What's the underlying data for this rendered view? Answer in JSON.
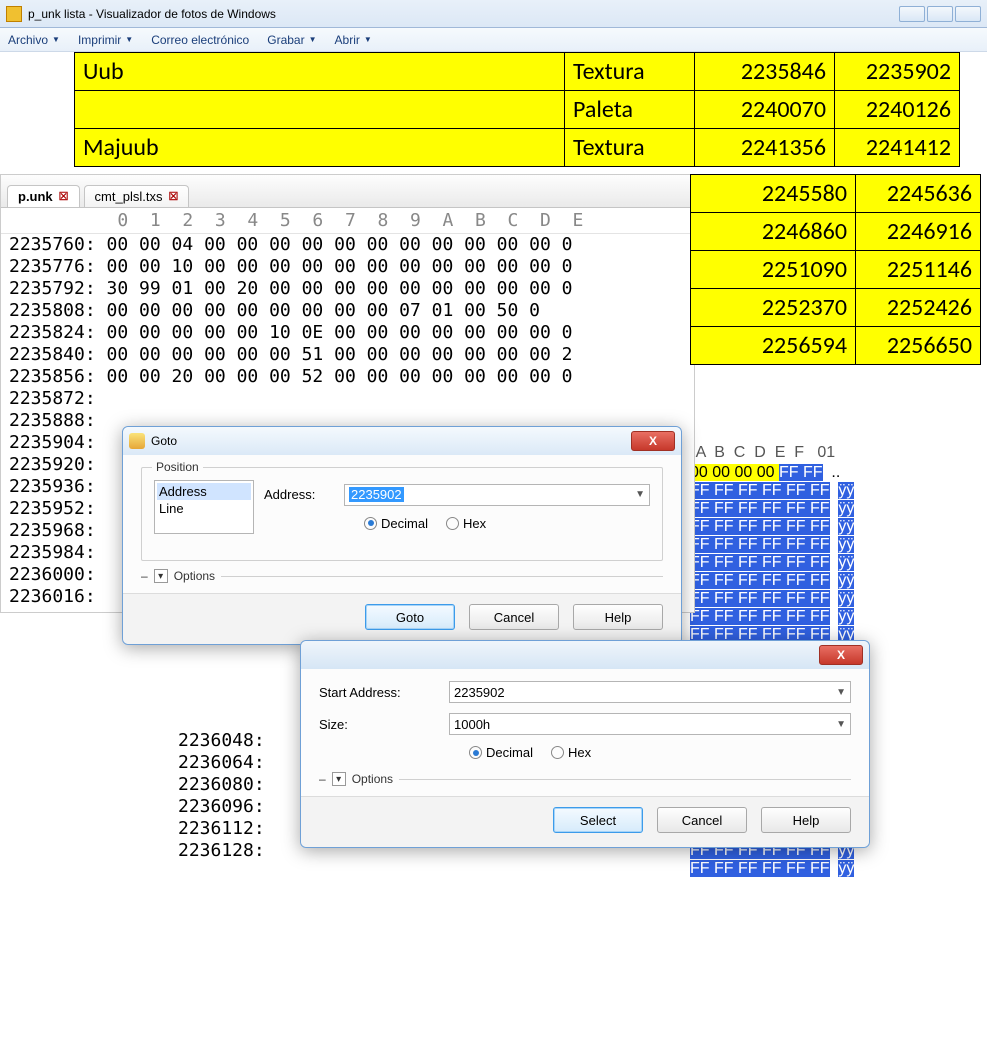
{
  "window": {
    "title": "p_unk lista - Visualizador de fotos de Windows"
  },
  "menubar": {
    "items": [
      "Archivo",
      "Imprimir",
      "Correo electrónico",
      "Grabar",
      "Abrir"
    ]
  },
  "yellow_table": {
    "rows": [
      {
        "name": "Uub",
        "type": "Textura",
        "a": "2235846",
        "b": "2235902"
      },
      {
        "name": "",
        "type": "Paleta",
        "a": "2240070",
        "b": "2240126"
      },
      {
        "name": "Majuub",
        "type": "Textura",
        "a": "2241356",
        "b": "2241412"
      }
    ],
    "tail": [
      {
        "a": "2245580",
        "b": "2245636"
      },
      {
        "a": "2246860",
        "b": "2246916"
      },
      {
        "a": "2251090",
        "b": "2251146"
      },
      {
        "a": "2252370",
        "b": "2252426"
      },
      {
        "a": "2256594",
        "b": "2256650"
      }
    ]
  },
  "hex_tabs": {
    "active": "p.unk",
    "other": "cmt_plsl.txs"
  },
  "hex_header": "          0  1  2  3  4  5  6  7  8  9  A  B  C  D  E",
  "hex_rows": [
    "2235760: 00 00 04 00 00 00 00 00 00 00 00 00 00 00 0",
    "2235776: 00 00 10 00 00 00 00 00 00 00 00 00 00 00 0",
    "2235792: 30 99 01 00 20 00 00 00 00 00 00 00 00 00 0",
    "2235808: 00 00 00 00 00 00 00 00 00 07 01 00 50 0",
    "2235824: 00 00 00 00 00 10 0E 00 00 00 00 00 00 00 0",
    "2235840: 00 00 00 00 00 00 51 00 00 00 00 00 00 00 2",
    "2235856: 00 00 20 00 00 00 52 00 00 00 00 00 00 00 0",
    "2235872:",
    "2235888:",
    "2235904:",
    "2235920:",
    "2235936:",
    "2235952:",
    "2235968:",
    "2235984:",
    "2236000:",
    "2236016:"
  ],
  "hex2_rows": [
    "2236048:",
    "2236064:",
    "2236080:",
    "2236096:",
    "2236112:",
    "2236128:"
  ],
  "right_view": {
    "cols": " A  B  C  D  E  F   01",
    "yellow_hex": "00 00 00 00 ",
    "yellow_ff": "FF FF",
    "yellow_ascii": "..",
    "blue_hex": "FF FF FF FF FF FF",
    "blue_ascii": "ÿÿ"
  },
  "goto_dialog": {
    "title": "Goto",
    "group": "Position",
    "list": [
      "Address",
      "Line"
    ],
    "label_address": "Address:",
    "value": "2235902",
    "radio_decimal": "Decimal",
    "radio_hex": "Hex",
    "options": "Options",
    "btn_goto": "Goto",
    "btn_cancel": "Cancel",
    "btn_help": "Help"
  },
  "select_dialog": {
    "label_start": "Start Address:",
    "value_start": "2235902",
    "label_size": "Size:",
    "value_size": "1000h",
    "radio_decimal": "Decimal",
    "radio_hex": "Hex",
    "options": "Options",
    "btn_select": "Select",
    "btn_cancel": "Cancel",
    "btn_help": "Help"
  }
}
